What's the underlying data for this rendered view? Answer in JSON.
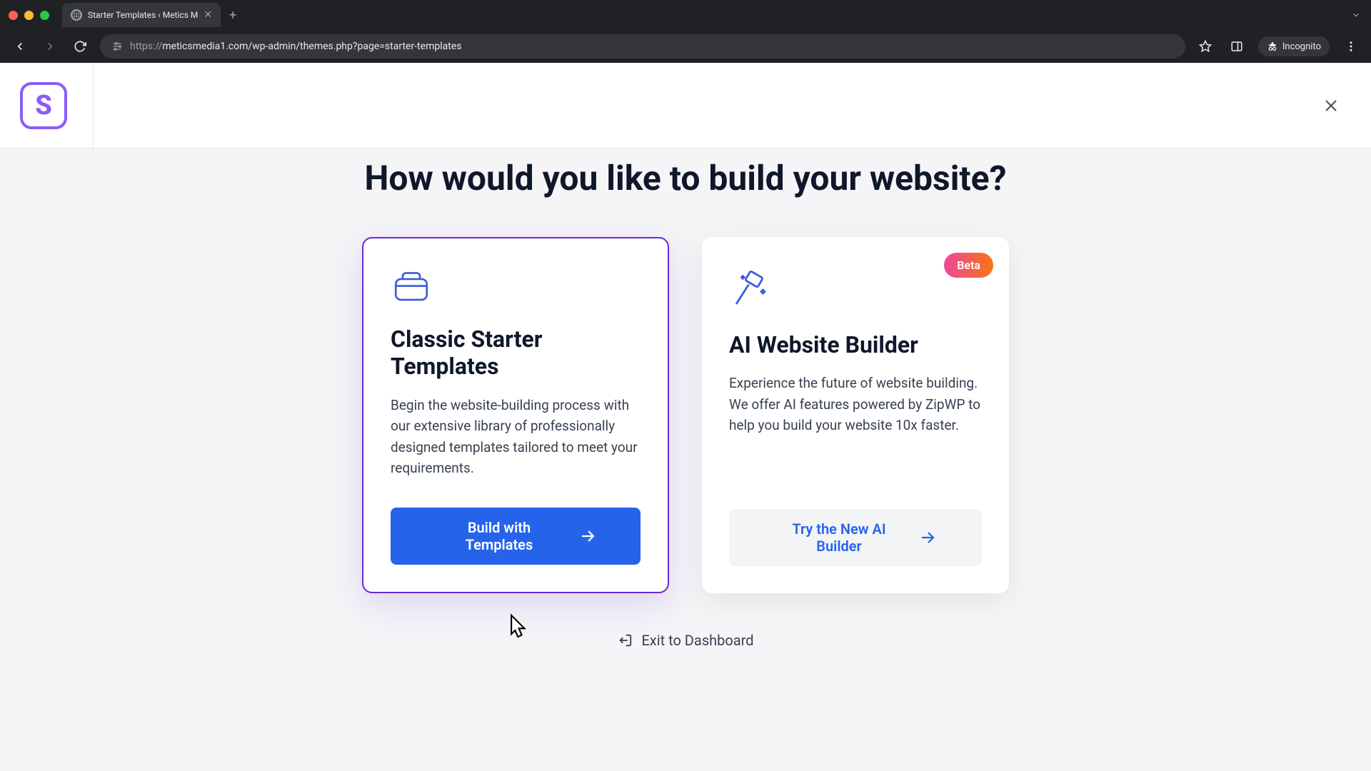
{
  "browser": {
    "tab_title": "Starter Templates ‹ Metics M",
    "url_prefix": "https://",
    "url_rest": "meticsmedia1.com/wp-admin/themes.php?page=starter-templates",
    "incognito_label": "Incognito"
  },
  "header": {
    "logo_letter": "S"
  },
  "hero": {
    "title": "How would you like to build your website?"
  },
  "cards": {
    "classic": {
      "title": "Classic Starter Templates",
      "description": "Begin the website-building process with our extensive library of professionally designed templates tailored to meet your requirements.",
      "button_label": "Build with Templates"
    },
    "ai": {
      "badge": "Beta",
      "title": "AI Website Builder",
      "description": "Experience the future of website building. We offer AI features powered by ZipWP to help you build your website 10x faster.",
      "button_label": "Try the New AI Builder"
    }
  },
  "footer": {
    "exit_label": "Exit to Dashboard"
  }
}
